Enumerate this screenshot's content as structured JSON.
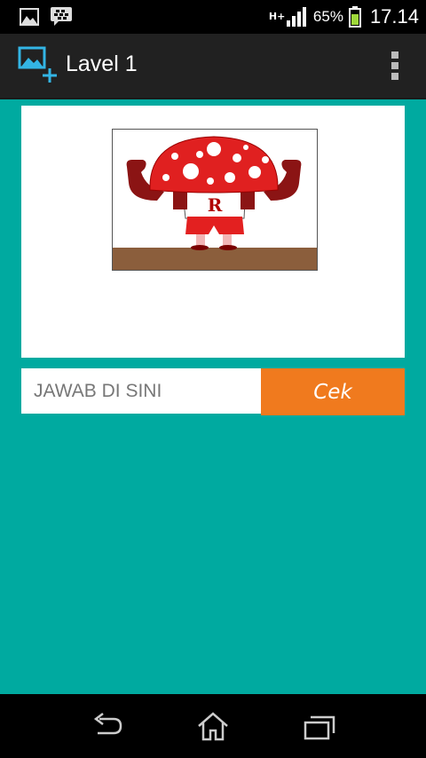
{
  "status_bar": {
    "network_type": "H+",
    "battery_percent": "65%",
    "time": "17.14",
    "notification_icons": [
      "gallery-icon",
      "bbm-icon"
    ]
  },
  "action_bar": {
    "title": "Lavel 1",
    "app_icon": "add-image-icon",
    "menu_icon": "overflow-menu-icon"
  },
  "puzzle": {
    "image": "muscular-mushroom-with-letter-r",
    "image_letter": "R"
  },
  "answer": {
    "placeholder": "JAWAB DI SINI",
    "value": "",
    "submit_label": "Cek"
  },
  "colors": {
    "background": "#00aaa0",
    "button": "#f07a1e",
    "action_bar": "#212121"
  },
  "nav_bar": [
    "back-icon",
    "home-icon",
    "recent-apps-icon"
  ]
}
